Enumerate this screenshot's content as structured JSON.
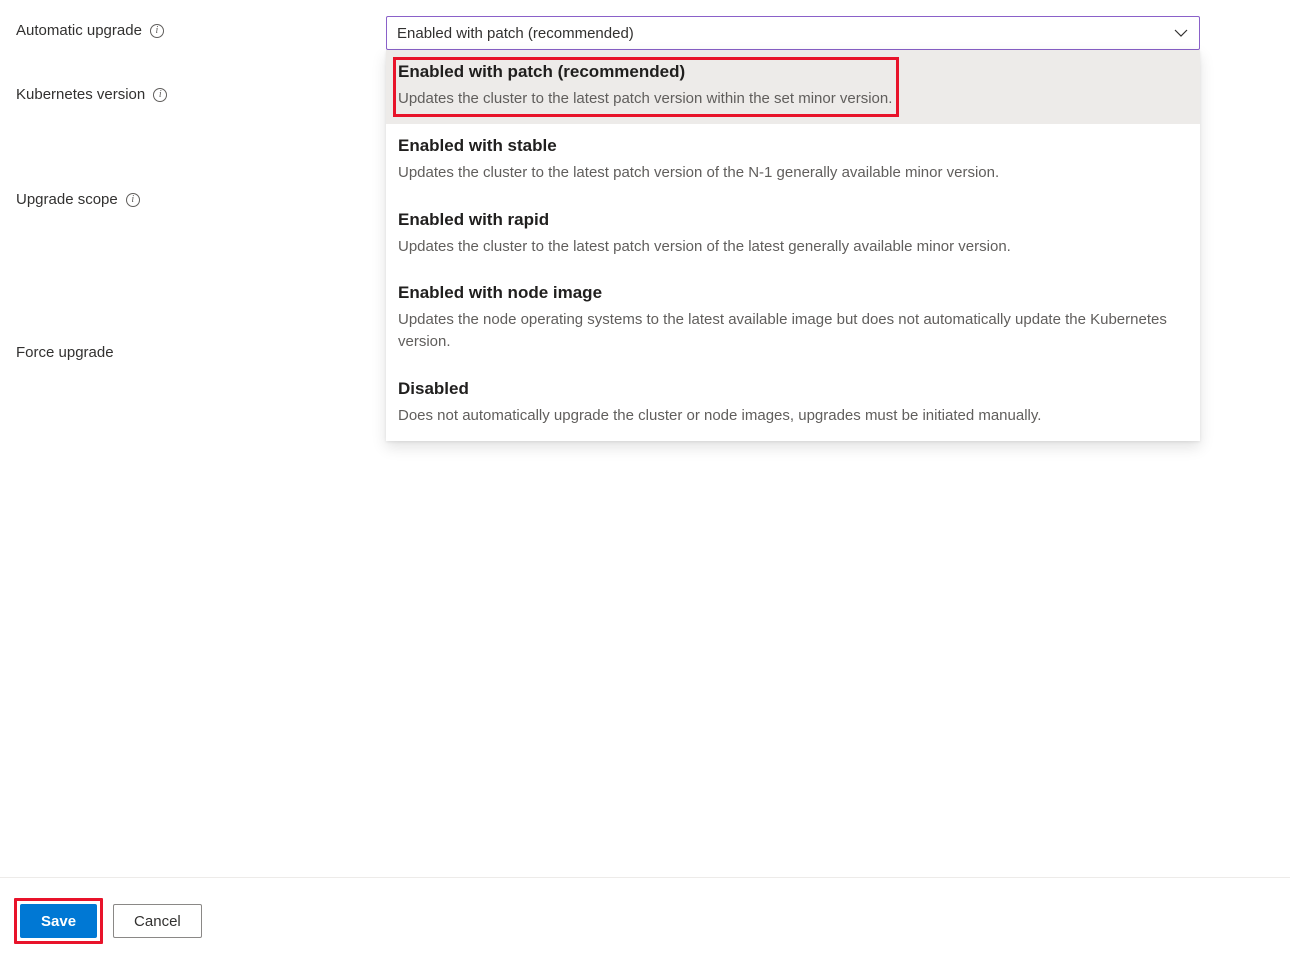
{
  "fields": {
    "automatic_upgrade": {
      "label": "Automatic upgrade"
    },
    "kubernetes_version": {
      "label": "Kubernetes version"
    },
    "upgrade_scope": {
      "label": "Upgrade scope"
    },
    "force_upgrade": {
      "label": "Force upgrade"
    }
  },
  "dropdown": {
    "selected": "Enabled with patch (recommended)",
    "options": [
      {
        "title": "Enabled with patch (recommended)",
        "desc": "Updates the cluster to the latest patch version within the set minor version."
      },
      {
        "title": "Enabled with stable",
        "desc": "Updates the cluster to the latest patch version of the N-1 generally available minor version."
      },
      {
        "title": "Enabled with rapid",
        "desc": "Updates the cluster to the latest patch version of the latest generally available minor version."
      },
      {
        "title": "Enabled with node image",
        "desc": "Updates the node operating systems to the latest available image but does not automatically update the Kubernetes version."
      },
      {
        "title": "Disabled",
        "desc": "Does not automatically upgrade the cluster or node images, upgrades must be initiated manually."
      }
    ]
  },
  "buttons": {
    "save": "Save",
    "cancel": "Cancel"
  }
}
